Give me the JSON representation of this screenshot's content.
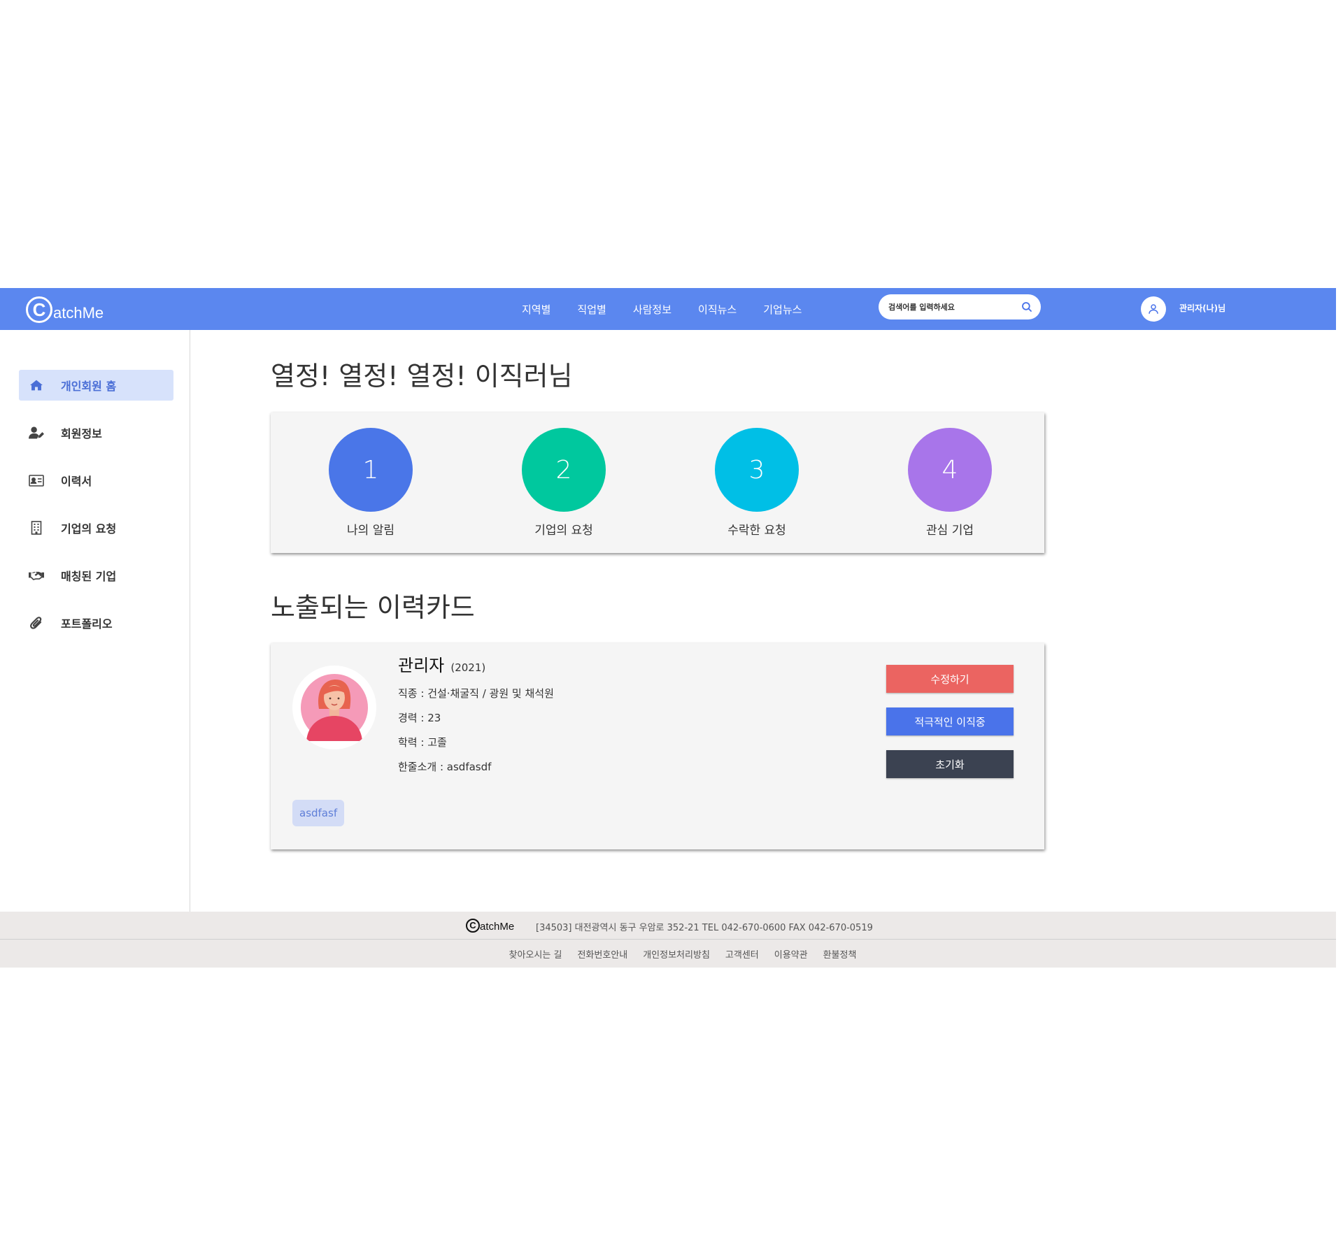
{
  "header": {
    "logo_letter": "C",
    "logo_text": "atchMe",
    "nav": [
      "지역별",
      "직업별",
      "사람정보",
      "이직뉴스",
      "기업뉴스"
    ],
    "search_placeholder": "검색어를 입력하세요",
    "user_name": "관리자(나)님",
    "brand_color": "#5b87ef"
  },
  "sidebar": {
    "items": [
      {
        "label": "개인회원 홈",
        "icon": "home-icon",
        "active": true
      },
      {
        "label": "회원정보",
        "icon": "user-edit-icon"
      },
      {
        "label": "이력서",
        "icon": "id-card-icon"
      },
      {
        "label": "기업의 요청",
        "icon": "building-icon"
      },
      {
        "label": "매칭된 기업",
        "icon": "handshake-icon"
      },
      {
        "label": "포트폴리오",
        "icon": "paperclip-icon"
      }
    ]
  },
  "main": {
    "greeting": "열정! 열정! 열정! 이직러님",
    "stats": [
      {
        "value": "1",
        "label": "나의 알림",
        "color": "#4a76e8"
      },
      {
        "value": "2",
        "label": "기업의 요청",
        "color": "#00c89e"
      },
      {
        "value": "3",
        "label": "수락한 요청",
        "color": "#00bfe6"
      },
      {
        "value": "4",
        "label": "관심 기업",
        "color": "#a875ea"
      }
    ],
    "card_section_title": "노출되는 이력카드",
    "card": {
      "name": "관리자",
      "year": "(2021)",
      "job": "직종 : 건설·채굴직 / 광원 및 채석원",
      "career": "경력 : 23",
      "education": "학력 : 고졸",
      "intro": "한줄소개 : asdfasdf",
      "tag": "asdfasf",
      "buttons": {
        "edit": "수정하기",
        "status": "적극적인 이직중",
        "reset": "초기화"
      }
    }
  },
  "footer": {
    "logo_letter": "C",
    "logo_text": "atchMe",
    "address": "[34503] 대전광역시 동구 우암로 352-21 TEL 042-670-0600 FAX 042-670-0519",
    "links": [
      "찾아오시는 길",
      "전화번호안내",
      "개인정보처리방침",
      "고객센터",
      "이용약관",
      "환불정책"
    ]
  }
}
